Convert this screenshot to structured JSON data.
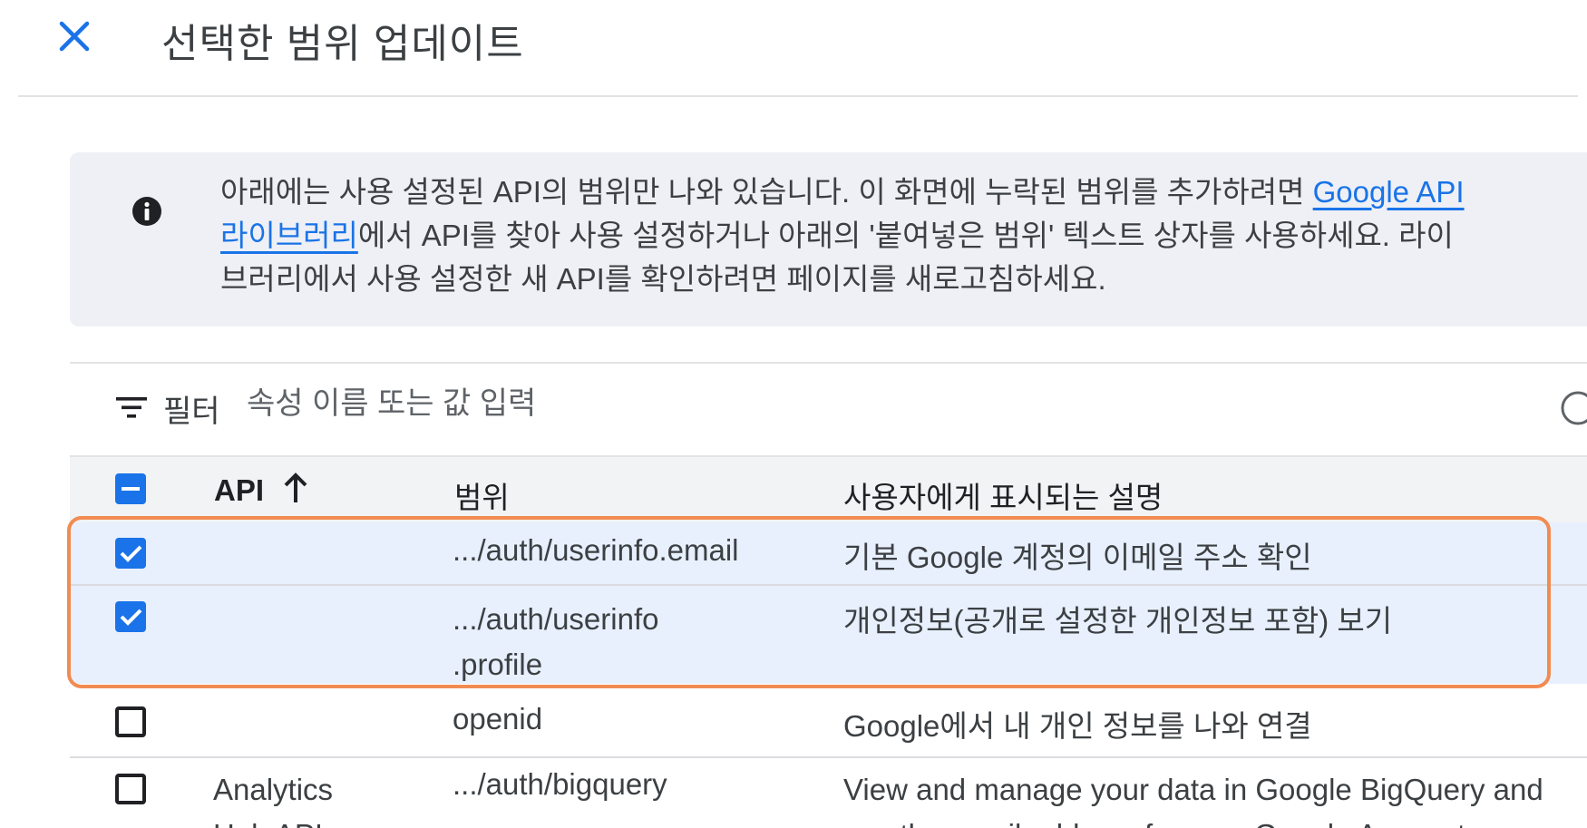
{
  "header": {
    "title": "선택한 범위 업데이트"
  },
  "info": {
    "line1_text": "아래에는 사용 설정된 API의 범위만 나와 있습니다. 이 화면에 누락된 범위를 추가하려면 ",
    "line1_link": "Google API",
    "line2_link": "라이브러리",
    "line2_text": "에서 API를 찾아 사용 설정하거나 아래의 '붙여넣은 범위' 텍스트 상자를 사용하세요. 라이",
    "line3_text": "브러리에서 사용 설정한 새 API를 확인하려면 페이지를 새로고침하세요."
  },
  "filter": {
    "label": "필터",
    "placeholder": "속성 이름 또는 값 입력"
  },
  "table": {
    "headers": {
      "api": "API",
      "scope": "범위",
      "description": "사용자에게 표시되는 설명"
    },
    "rows": [
      {
        "checked": true,
        "api": "",
        "scope": ".../auth/userinfo.email",
        "description": "기본 Google 계정의 이메일 주소 확인"
      },
      {
        "checked": true,
        "api": "",
        "scope_line1": ".../auth/userinfo",
        "scope_line2": ".profile",
        "description": "개인정보(공개로 설정한 개인정보 포함) 보기"
      },
      {
        "checked": false,
        "api": "",
        "scope": "openid",
        "description": "Google에서 내 개인 정보를 나와 연결"
      },
      {
        "checked": false,
        "api_line1": "Analytics",
        "api_line2": "Hub API",
        "scope": ".../auth/bigquery",
        "description_line1": "View and manage your data in Google BigQuery and",
        "description_line2": "see the email address for your Google Account"
      }
    ]
  },
  "colors": {
    "accent": "#1a73e8",
    "highlight_border": "#f28b51",
    "selected_row": "#e8f0fe",
    "info_bg": "#eef0f5"
  }
}
